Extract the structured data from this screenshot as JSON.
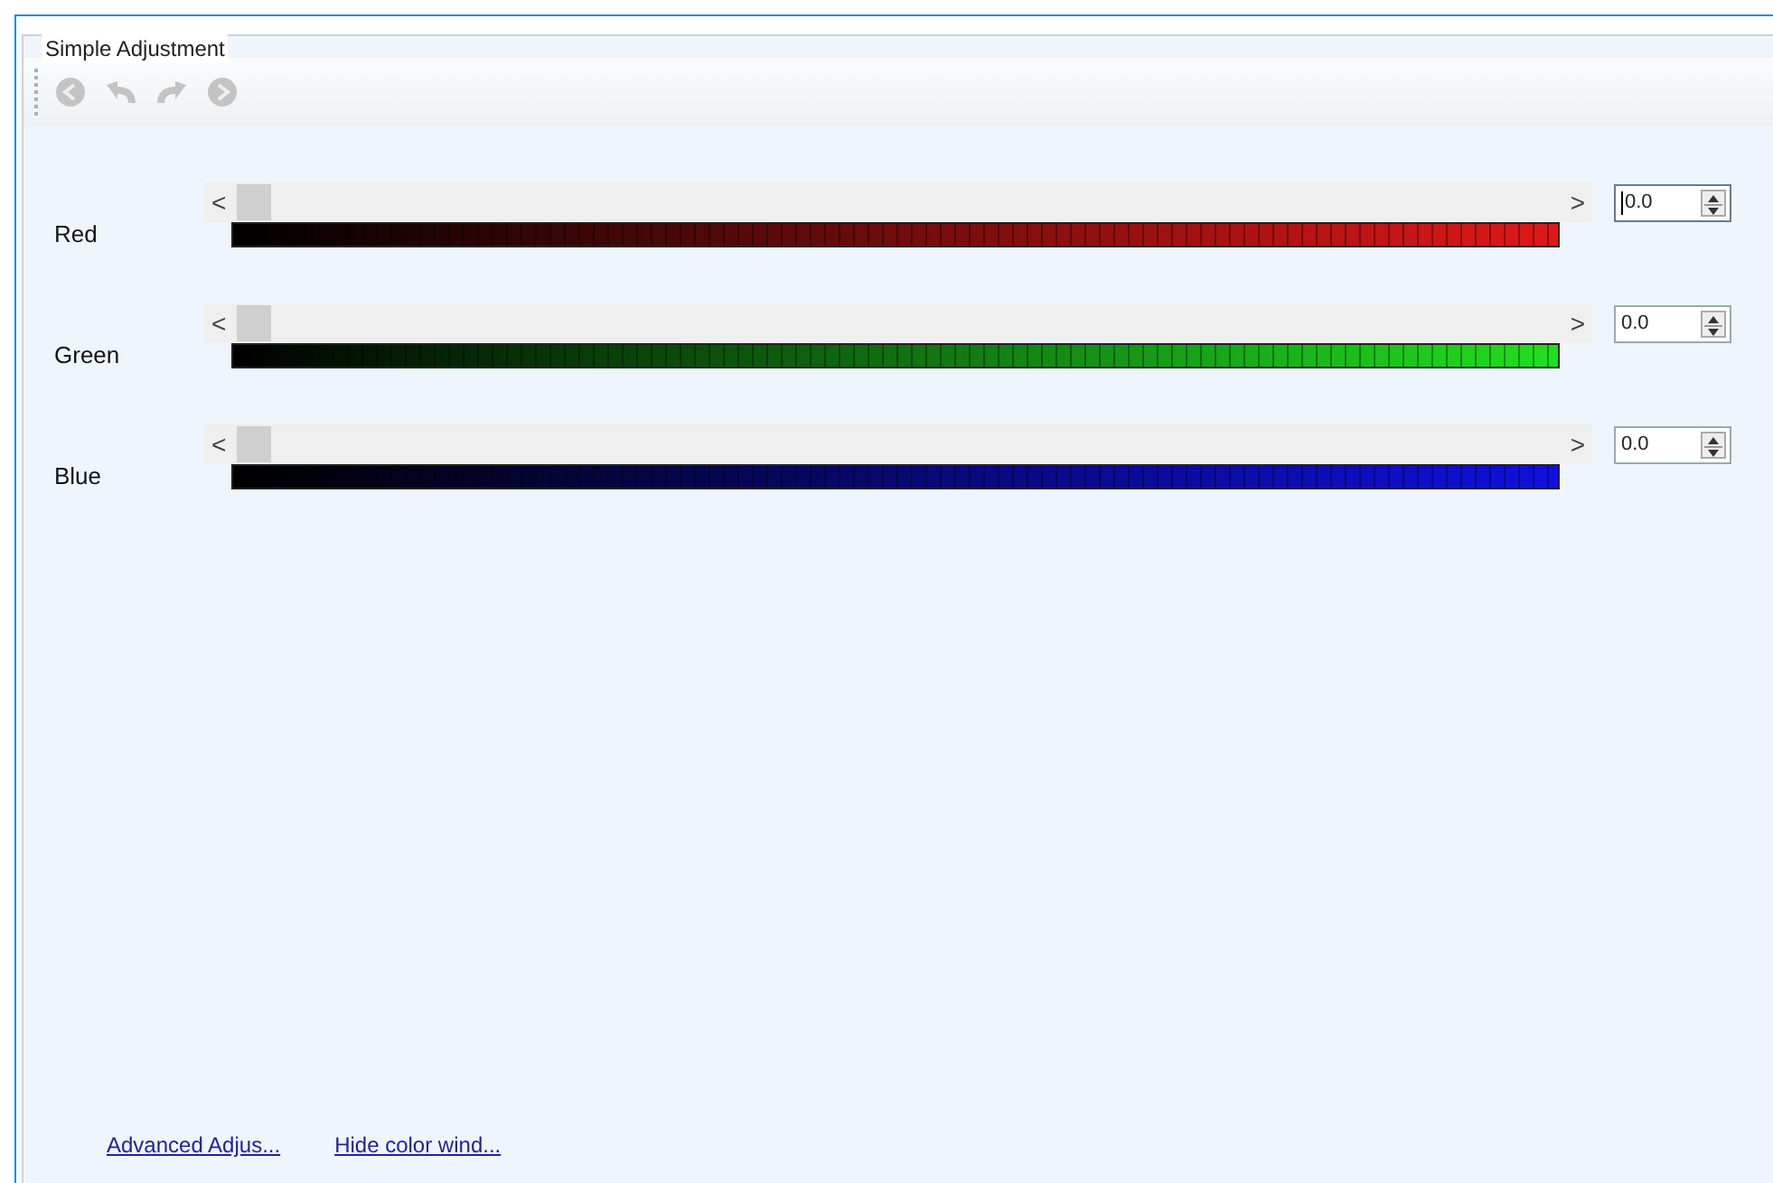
{
  "group": {
    "title": "Simple Adjustment"
  },
  "toolbar": [
    {
      "kind": "back",
      "disabled": true
    },
    {
      "kind": "undo",
      "disabled": true
    },
    {
      "kind": "redo",
      "disabled": true
    },
    {
      "kind": "forward",
      "disabled": true
    }
  ],
  "channels": [
    {
      "name": "Red",
      "level": 0,
      "color": "#e01818",
      "left_arrow": "<",
      "right_arrow": ">",
      "value": "0.0",
      "focused": true
    },
    {
      "name": "Green",
      "level": 0,
      "color": "#20e020",
      "left_arrow": "<",
      "right_arrow": ">",
      "value": "0.0",
      "focused": false
    },
    {
      "name": "Blue",
      "level": 0,
      "color": "#1010e0",
      "left_arrow": "<",
      "right_arrow": ">",
      "value": "0.0",
      "focused": false
    }
  ],
  "links": [
    "Advanced Adjus...",
    "Hide color wind..."
  ]
}
